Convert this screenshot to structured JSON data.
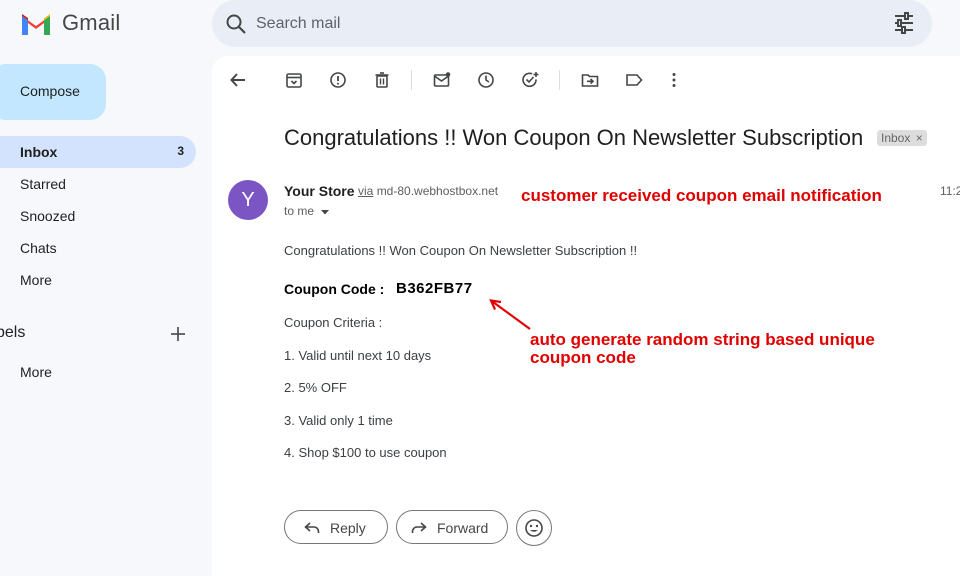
{
  "header": {
    "app_name": "Gmail",
    "search_placeholder": "Search mail"
  },
  "sidebar": {
    "compose_label": "Compose",
    "items": [
      {
        "label": "Inbox",
        "count": "3",
        "active": true
      },
      {
        "label": "Starred"
      },
      {
        "label": "Snoozed"
      },
      {
        "label": "Chats"
      },
      {
        "label": "More"
      }
    ],
    "labels_heading": "bels",
    "labels_more": "More"
  },
  "toolbar": {
    "icons": [
      "back-arrow-icon",
      "archive-icon",
      "report-spam-icon",
      "delete-icon",
      "mark-unread-icon",
      "snooze-icon",
      "add-task-icon",
      "move-to-icon",
      "label-icon",
      "more-vert-icon"
    ]
  },
  "email": {
    "subject": "Congratulations !! Won Coupon On Newsletter Subscription",
    "tag": "Inbox",
    "avatar_letter": "Y",
    "avatar_color": "#7b55c3",
    "sender": "Your Store",
    "via_word": "via",
    "via_domain": "md-80.webhostbox.net",
    "recipient": "to me",
    "time": "11:2",
    "body_intro": "Congratulations !! Won Coupon On Newsletter Subscription !!",
    "coupon_label": "Coupon Code : ",
    "coupon_code": "B362FB77",
    "criteria_heading": "Coupon Criteria :",
    "criteria": [
      "1. Valid until next 10 days",
      "2. 5% OFF",
      "3. Valid only 1 time",
      "4. Shop $100 to use coupon"
    ]
  },
  "annotations": {
    "notification": "customer received coupon email notification",
    "code_line1": "auto generate random string based unique",
    "code_line2": "coupon code",
    "color": "#e00000"
  },
  "actions": {
    "reply": "Reply",
    "forward": "Forward"
  }
}
